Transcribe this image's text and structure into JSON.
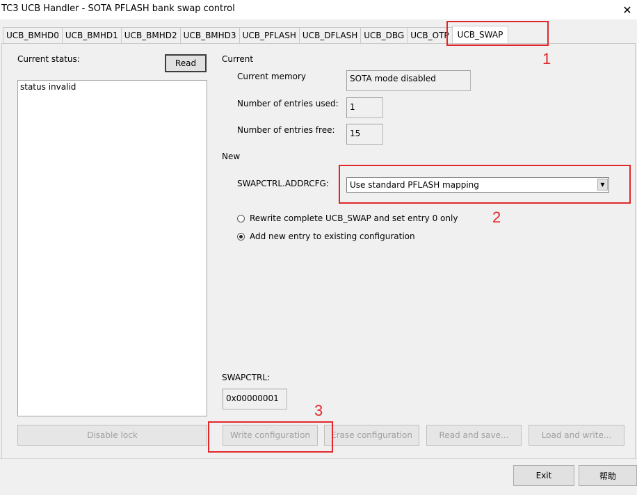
{
  "window": {
    "title": "TC3 UCB Handler - SOTA PFLASH bank swap control",
    "close_glyph": "✕"
  },
  "tabs": [
    {
      "label": "UCB_BMHD0"
    },
    {
      "label": "UCB_BMHD1"
    },
    {
      "label": "UCB_BMHD2"
    },
    {
      "label": "UCB_BMHD3"
    },
    {
      "label": "UCB_PFLASH"
    },
    {
      "label": "UCB_DFLASH"
    },
    {
      "label": "UCB_DBG"
    },
    {
      "label": "UCB_OTP"
    },
    {
      "label": "UCB_SWAP",
      "active": true
    }
  ],
  "status": {
    "label": "Current status:",
    "read_button": "Read",
    "lines": [
      "status invalid"
    ]
  },
  "current": {
    "heading": "Current",
    "memory_label": "Current memory",
    "memory_value": "SOTA mode disabled",
    "used_label": "Number of entries used:",
    "used_value": "1",
    "free_label": "Number of entries free:",
    "free_value": "15"
  },
  "new": {
    "heading": "New",
    "addrcfg_label": "SWAPCTRL.ADDRCFG:",
    "addrcfg_value": "Use standard PFLASH mapping",
    "radio_rewrite": "Rewrite complete UCB_SWAP and set entry 0 only",
    "radio_add": "Add new entry to existing configuration",
    "selected_radio": "add"
  },
  "swapctrl": {
    "label": "SWAPCTRL:",
    "value": "0x00000001"
  },
  "actions": {
    "disable_lock": "Disable lock",
    "write_configuration": "Write configuration",
    "erase_configuration": "Erase configuration",
    "read_and_save": "Read and save...",
    "load_and_write": "Load and write..."
  },
  "footer": {
    "exit": "Exit",
    "help": "帮助"
  },
  "annotations": {
    "color": "#e0282a",
    "num1": "1",
    "num2": "2",
    "num3": "3"
  }
}
